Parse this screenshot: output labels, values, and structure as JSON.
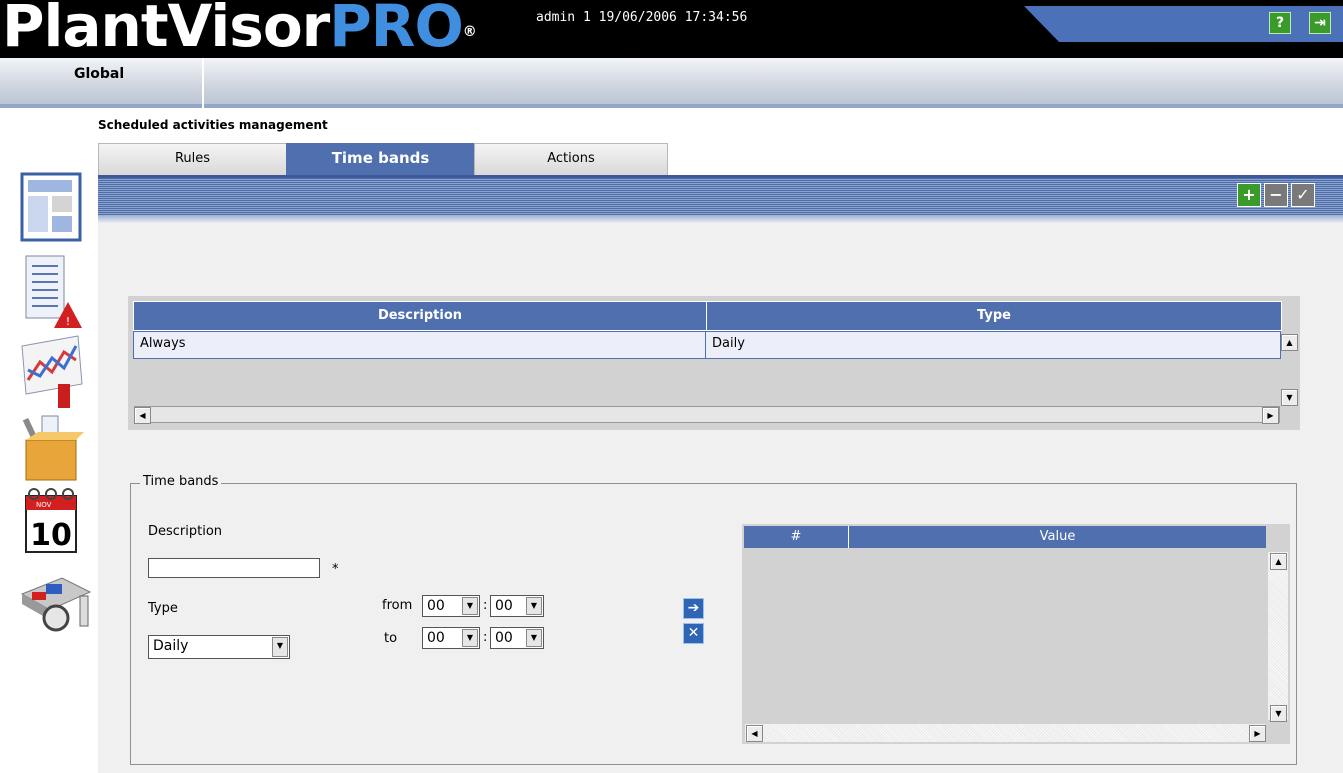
{
  "header": {
    "logo_main": "PlantVisor",
    "logo_accent": "PRO",
    "logo_reg": "®",
    "user_info": "admin 1 19/06/2006 17:34:56",
    "help_icon": "help-icon",
    "exit_icon": "exit-icon",
    "accent_color": "#4b72b8"
  },
  "nav": {
    "global_label": "Global"
  },
  "page": {
    "title": "Scheduled activities management"
  },
  "tabs": [
    {
      "label": "Rules",
      "active": false
    },
    {
      "label": "Time bands",
      "active": true
    },
    {
      "label": "Actions",
      "active": false
    }
  ],
  "toolbar": {
    "add_icon": "plus-icon",
    "remove_icon": "minus-icon",
    "confirm_icon": "check-icon"
  },
  "sidebar": {
    "items": [
      {
        "icon": "site-layout-icon"
      },
      {
        "icon": "alarm-report-icon"
      },
      {
        "icon": "graph-icon"
      },
      {
        "icon": "tools-box-icon"
      },
      {
        "icon": "calendar-icon",
        "text": "10",
        "month": "NOV"
      },
      {
        "icon": "device-config-icon"
      }
    ]
  },
  "table": {
    "columns": [
      "Description",
      "Type"
    ],
    "rows": [
      {
        "description": "Always",
        "type": "Daily"
      }
    ]
  },
  "form": {
    "legend": "Time bands",
    "description_label": "Description",
    "description_value": "",
    "required_mark": "*",
    "type_label": "Type",
    "type_value": "Daily",
    "from_label": "from",
    "to_label": "to",
    "from_hour": "00",
    "from_minute": "00",
    "to_hour": "00",
    "to_minute": "00",
    "time_separator": ":",
    "add_band_icon": "arrow-right-icon",
    "delete_band_icon": "delete-icon"
  },
  "bands_table": {
    "columns": [
      "#",
      "Value"
    ],
    "rows": []
  }
}
